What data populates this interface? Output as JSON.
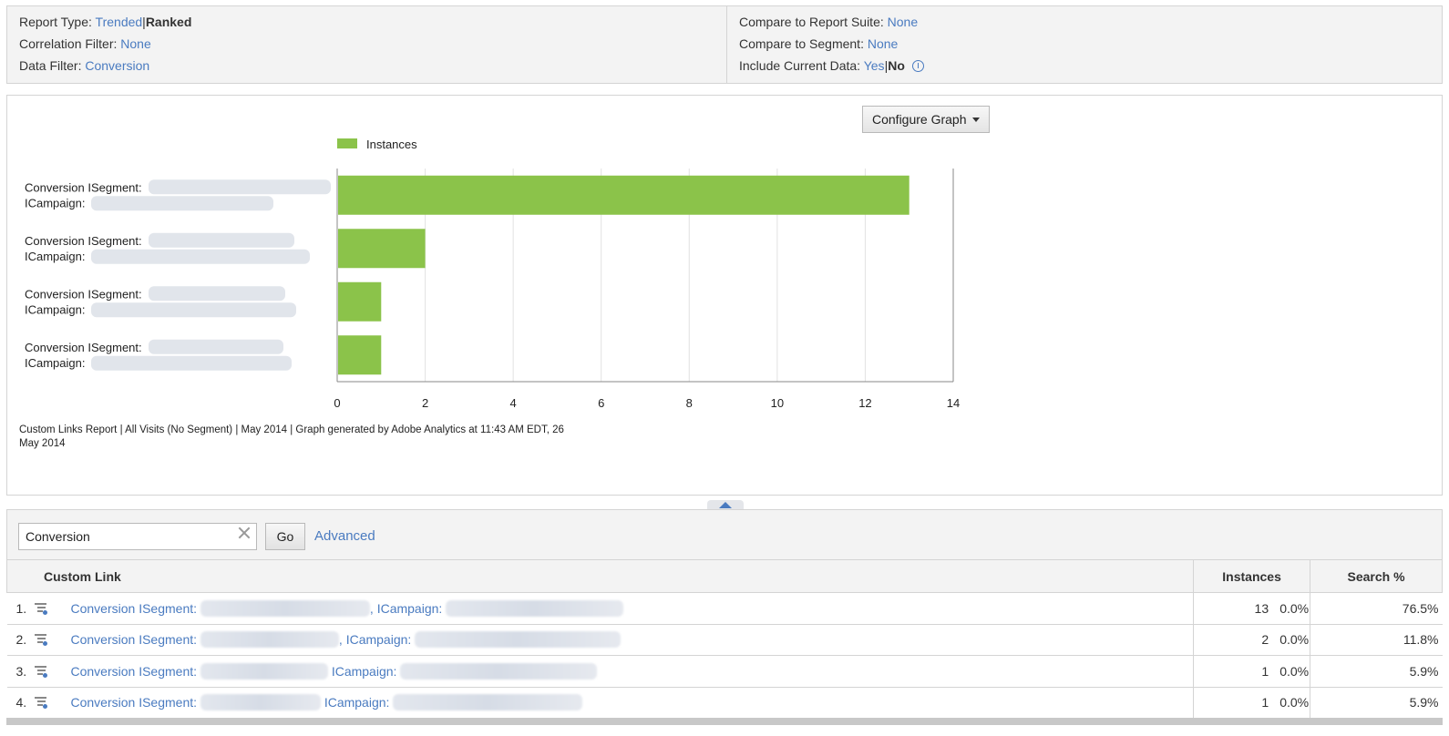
{
  "info": {
    "report_type_label": "Report Type:",
    "report_type_trended": "Trended",
    "report_type_sep": "|",
    "report_type_ranked": "Ranked",
    "correlation_filter_label": "Correlation Filter:",
    "correlation_filter_value": "None",
    "data_filter_label": "Data Filter:",
    "data_filter_value": "Conversion",
    "compare_suite_label": "Compare to Report Suite:",
    "compare_suite_value": "None",
    "compare_segment_label": "Compare to Segment:",
    "compare_segment_value": "None",
    "include_current_label": "Include Current Data:",
    "include_current_yes": "Yes",
    "include_current_sep": "|",
    "include_current_no": "No"
  },
  "graph": {
    "configure_label": "Configure Graph",
    "footnote": "Custom Links Report | All Visits (No Segment) | May 2014 | Graph generated by Adobe Analytics at 11:43 AM EDT, 26 May 2014"
  },
  "chart_data": {
    "type": "bar",
    "orientation": "horizontal",
    "categories": [
      "Conversion ISegment: … ICampaign: …",
      "Conversion ISegment: … ICampaign: …",
      "Conversion ISegment: … ICampaign: …",
      "Conversion ISegment: … ICampaign: …"
    ],
    "category_line1": [
      "Conversion ISegment:",
      "Conversion ISegment:",
      "Conversion ISegment:",
      "Conversion ISegment:"
    ],
    "category_line2": [
      "ICampaign:",
      "ICampaign:",
      "ICampaign:",
      "ICampaign:"
    ],
    "series": [
      {
        "name": "Instances",
        "values": [
          13,
          2,
          1,
          1
        ],
        "color": "#8bc34a"
      }
    ],
    "xlim": [
      0,
      14
    ],
    "xticks": [
      "0",
      "2",
      "4",
      "6",
      "8",
      "10",
      "12",
      "14"
    ],
    "grid": true,
    "legend_position": "top-left"
  },
  "search": {
    "value": "Conversion",
    "go_label": "Go",
    "advanced_label": "Advanced"
  },
  "table": {
    "headers": {
      "link": "Custom Link",
      "instances": "Instances",
      "search_pct": "Search %"
    },
    "rows": [
      {
        "rank": "1.",
        "segment_label": "Conversion ISegment:",
        "campaign_label": ", ICampaign:",
        "instances": "13",
        "instances_pct": "0.0%",
        "search_pct": "76.5%"
      },
      {
        "rank": "2.",
        "segment_label": "Conversion ISegment:",
        "campaign_label": ", ICampaign:",
        "instances": "2",
        "instances_pct": "0.0%",
        "search_pct": "11.8%"
      },
      {
        "rank": "3.",
        "segment_label": "Conversion ISegment:",
        "campaign_label": "ICampaign:",
        "instances": "1",
        "instances_pct": "0.0%",
        "search_pct": "5.9%"
      },
      {
        "rank": "4.",
        "segment_label": "Conversion ISegment:",
        "campaign_label": "ICampaign:",
        "instances": "1",
        "instances_pct": "0.0%",
        "search_pct": "5.9%"
      }
    ]
  },
  "colors": {
    "accent": "#4a7bc0",
    "bar": "#8bc34a",
    "panel_bg": "#f3f3f3",
    "border": "#d4d4d4"
  }
}
